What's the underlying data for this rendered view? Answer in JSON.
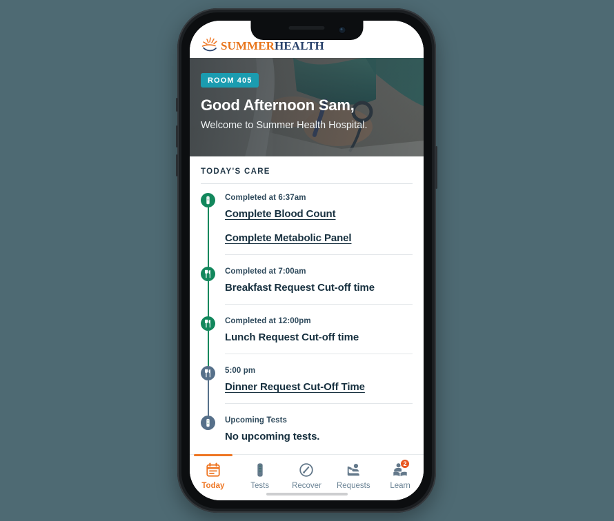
{
  "app": {
    "logo": {
      "icon": "sun-rays-icon",
      "word1": "SUMMER",
      "word2": "HEALTH"
    }
  },
  "hero": {
    "room_badge": "ROOM 405",
    "greeting": "Good Afternoon Sam,",
    "welcome": "Welcome to Summer Health Hospital."
  },
  "care": {
    "section_title": "TODAY'S CARE",
    "items": [
      {
        "icon": "test-tube-icon",
        "status": "done",
        "time": "Completed at 6:37am",
        "rows": [
          {
            "label": "Complete Blood Count",
            "link": true
          },
          {
            "label": "Complete Metabolic Panel",
            "link": true
          }
        ]
      },
      {
        "icon": "utensils-icon",
        "status": "done",
        "time": "Completed at 7:00am",
        "rows": [
          {
            "label": "Breakfast Request Cut-off time",
            "link": false
          }
        ]
      },
      {
        "icon": "utensils-icon",
        "status": "done",
        "time": "Completed at 12:00pm",
        "rows": [
          {
            "label": "Lunch Request Cut-off time",
            "link": false
          }
        ]
      },
      {
        "icon": "utensils-icon",
        "status": "pending",
        "time": "5:00 pm",
        "rows": [
          {
            "label": "Dinner Request Cut-Off Time",
            "link": true
          }
        ]
      },
      {
        "icon": "test-tube-icon",
        "status": "pending",
        "time": "Upcoming Tests",
        "rows": [
          {
            "label": "No upcoming tests.",
            "link": false
          }
        ]
      }
    ]
  },
  "tabbar": {
    "tabs": [
      {
        "icon": "calendar-icon",
        "label": "Today",
        "active": true,
        "badge": ""
      },
      {
        "icon": "test-tube-icon",
        "label": "Tests",
        "active": false,
        "badge": ""
      },
      {
        "icon": "gauge-icon",
        "label": "Recover",
        "active": false,
        "badge": ""
      },
      {
        "icon": "raise-hand-icon",
        "label": "Requests",
        "active": false,
        "badge": ""
      },
      {
        "icon": "person-reading-icon",
        "label": "Learn",
        "active": false,
        "badge": "2"
      }
    ]
  },
  "colors": {
    "brand_orange": "#EE7623",
    "brand_navy": "#28416B",
    "teal_badge": "#1B9CB0",
    "green_done": "#12875C",
    "slate_pending": "#56708A",
    "page_background": "#4E6A73"
  }
}
